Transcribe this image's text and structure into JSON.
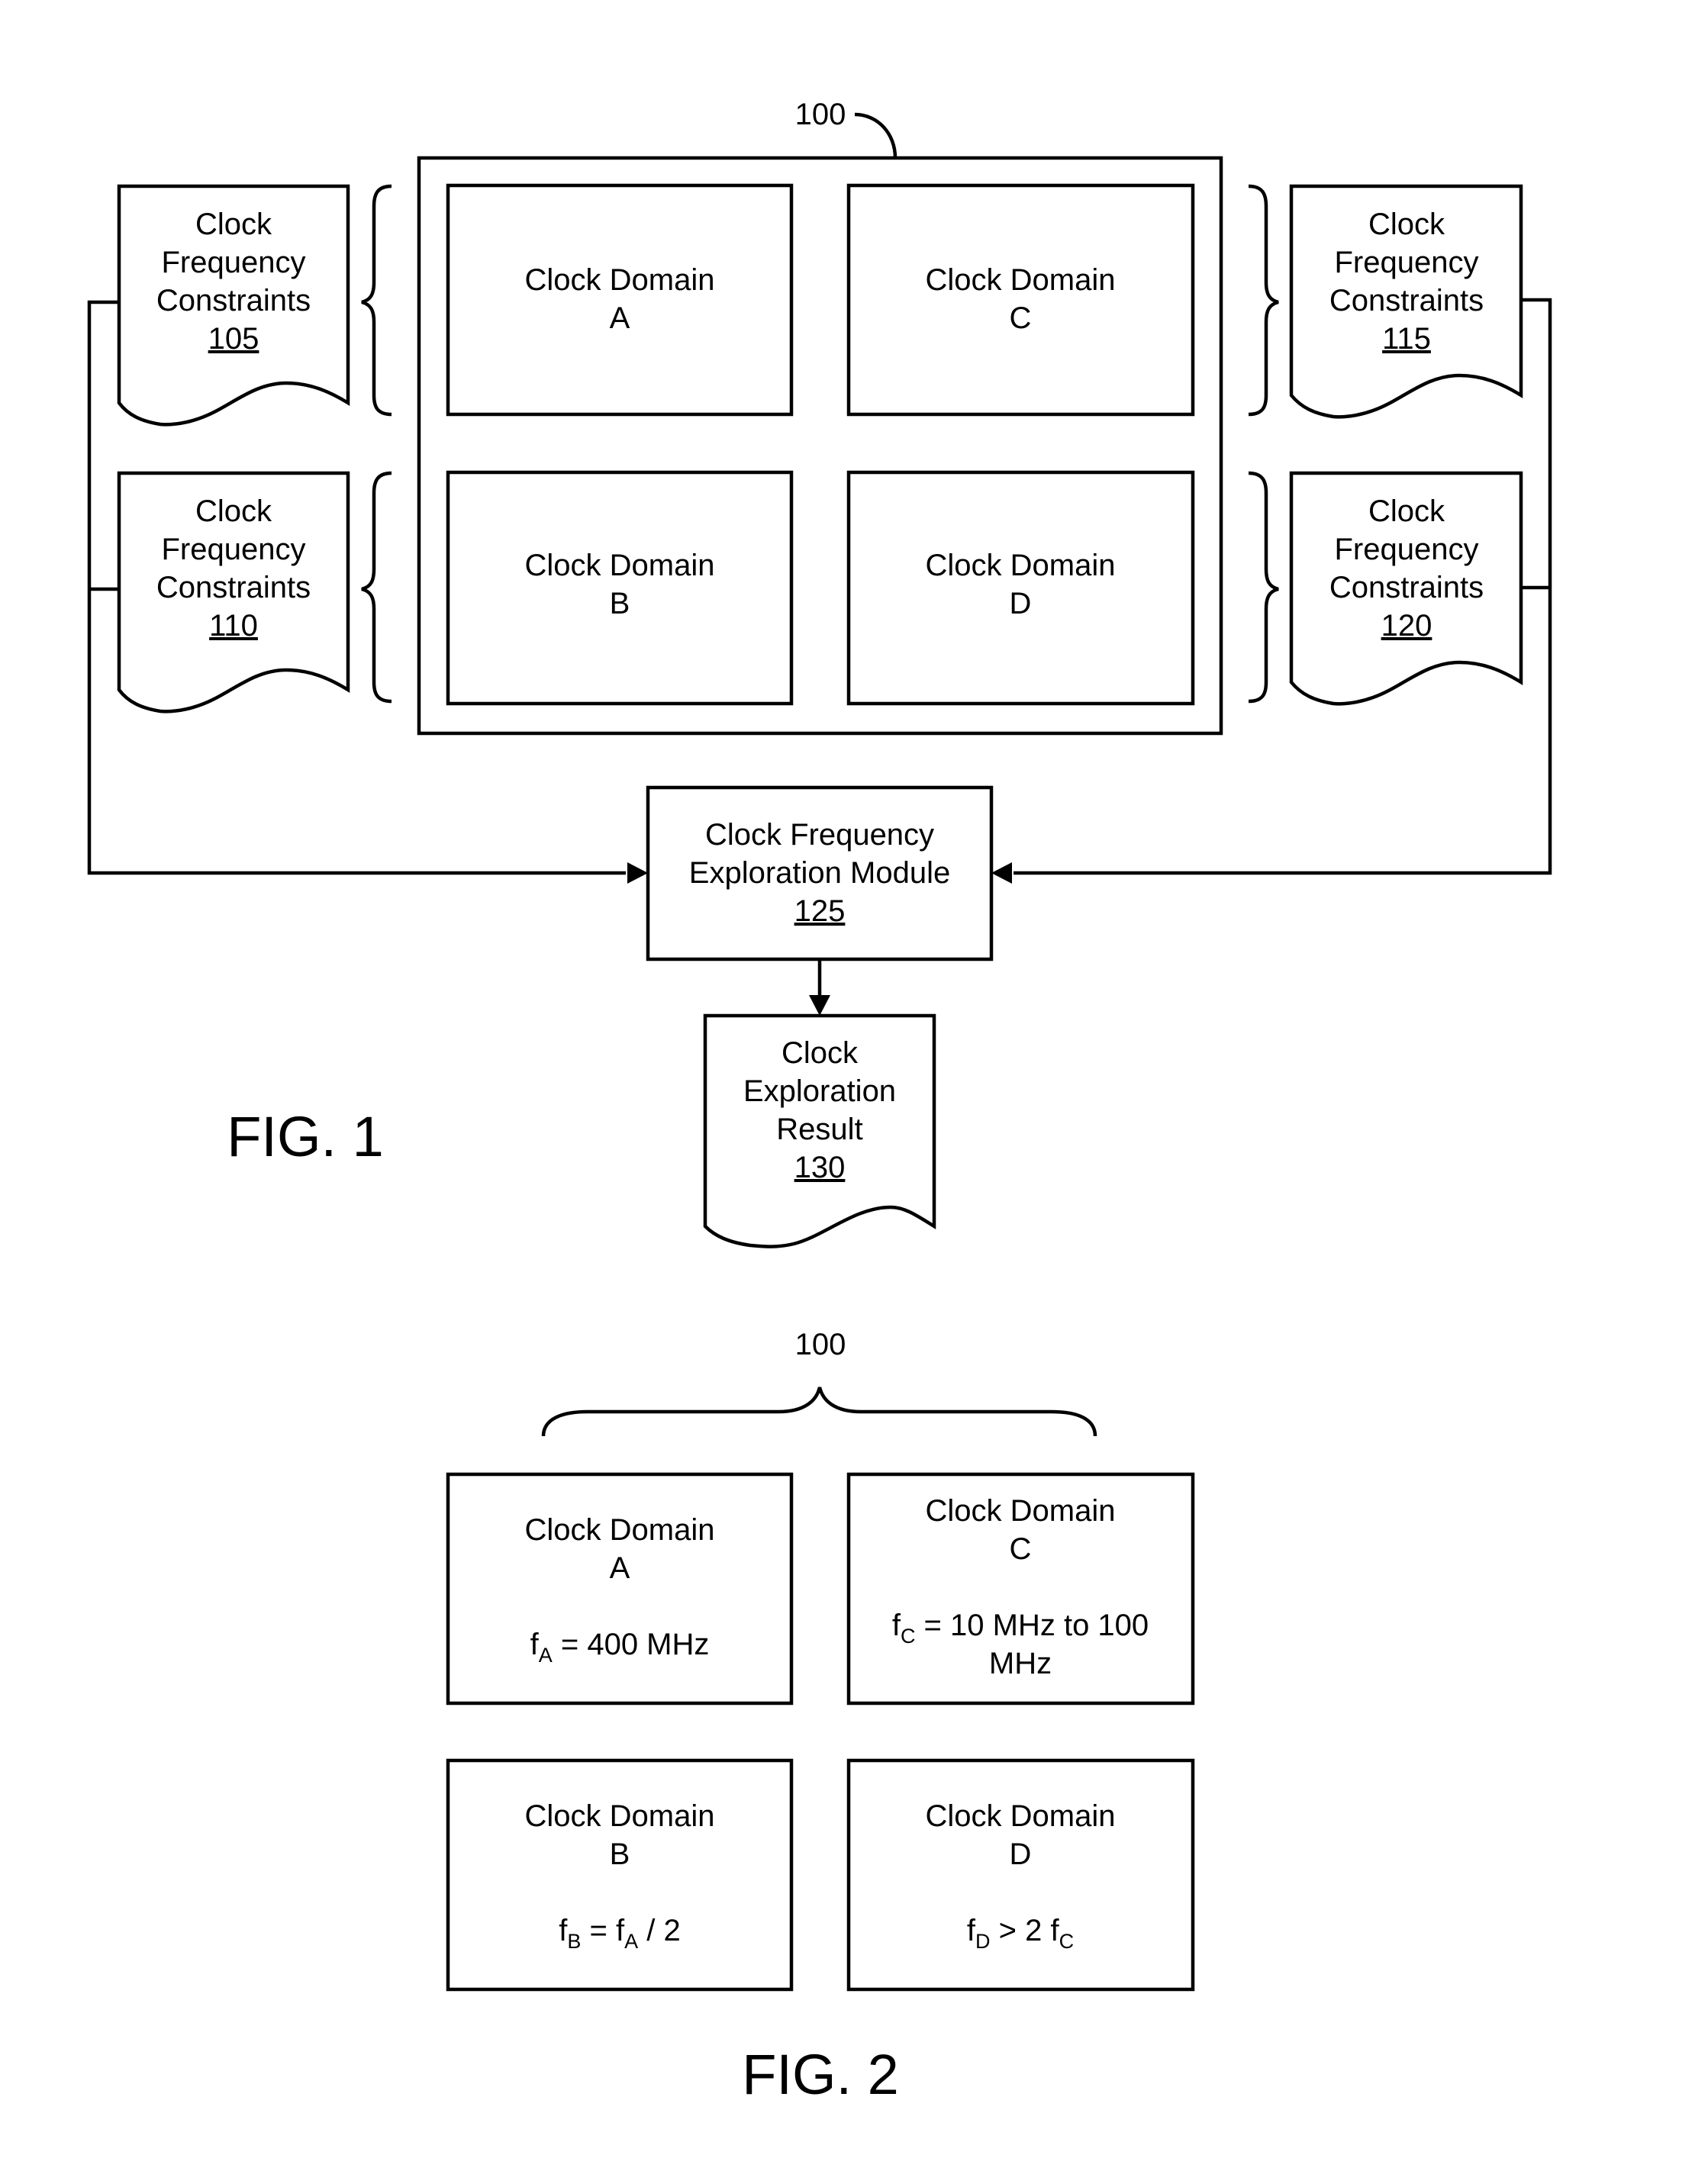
{
  "figure1": {
    "caption": "FIG. 1",
    "system": {
      "ref": "100"
    },
    "clock_domains": [
      {
        "line1": "Clock Domain",
        "line2": "A"
      },
      {
        "line1": "Clock Domain",
        "line2": "B"
      },
      {
        "line1": "Clock Domain",
        "line2": "C"
      },
      {
        "line1": "Clock Domain",
        "line2": "D"
      }
    ],
    "constraint_docs": [
      {
        "lines": [
          "Clock",
          "Frequency",
          "Constraints"
        ],
        "ref": "105"
      },
      {
        "lines": [
          "Clock",
          "Frequency",
          "Constraints"
        ],
        "ref": "110"
      },
      {
        "lines": [
          "Clock",
          "Frequency",
          "Constraints"
        ],
        "ref": "115"
      },
      {
        "lines": [
          "Clock",
          "Frequency",
          "Constraints"
        ],
        "ref": "120"
      }
    ],
    "module": {
      "lines": [
        "Clock Frequency",
        "Exploration Module"
      ],
      "ref": "125"
    },
    "result": {
      "lines": [
        "Clock",
        "Exploration",
        "Result"
      ],
      "ref": "130"
    }
  },
  "figure2": {
    "caption": "FIG. 2",
    "system": {
      "ref": "100"
    },
    "clock_domains": [
      {
        "line1": "Clock Domain",
        "line2": "A",
        "eq": {
          "f": "f",
          "sub": "A",
          "rest": " = 400 MHz"
        }
      },
      {
        "line1": "Clock Domain",
        "line2": "C",
        "eq": {
          "f": "f",
          "sub": "C",
          "rest": " = 10 MHz to 100",
          "cont": "MHz"
        }
      },
      {
        "line1": "Clock Domain",
        "line2": "B",
        "eq": {
          "f": "f",
          "sub": "B",
          "rest": " = ",
          "f2": "f",
          "sub2": "A",
          "rest2": " / 2"
        }
      },
      {
        "line1": "Clock Domain",
        "line2": "D",
        "eq": {
          "f": "f",
          "sub": "D",
          "rest": " > 2 ",
          "f2": "f",
          "sub2": "C",
          "rest2": ""
        }
      }
    ]
  }
}
